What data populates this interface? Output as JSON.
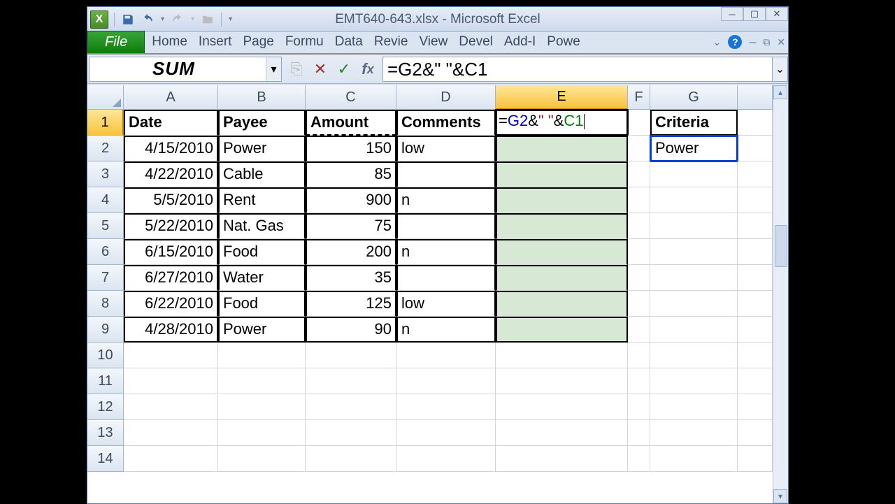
{
  "title": "EMT640-643.xlsx - Microsoft Excel",
  "tabs": {
    "file": "File",
    "home": "Home",
    "insert": "Insert",
    "page": "Page",
    "formulas": "Formu",
    "data": "Data",
    "review": "Revie",
    "view": "View",
    "devel": "Devel",
    "addins": "Add-I",
    "power": "Powe"
  },
  "namebox": "SUM",
  "formula": "=G2&\" \"&C1",
  "columns": [
    "A",
    "B",
    "C",
    "D",
    "E",
    "F",
    "G"
  ],
  "rows": [
    "1",
    "2",
    "3",
    "4",
    "5",
    "6",
    "7",
    "8",
    "9",
    "10",
    "11",
    "12",
    "13",
    "14"
  ],
  "headers": {
    "A": "Date",
    "B": "Payee",
    "C": "Amount",
    "D": "Comments",
    "G": "Criteria"
  },
  "editing_formula_parts": {
    "eq": "=",
    "g2": "G2",
    "amp1": "&",
    "str": "\" \"",
    "amp2": "&",
    "c1": "C1"
  },
  "data": [
    {
      "date": "4/15/2010",
      "payee": "Power",
      "amount": "150",
      "comments": "low"
    },
    {
      "date": "4/22/2010",
      "payee": "Cable",
      "amount": "85",
      "comments": ""
    },
    {
      "date": "5/5/2010",
      "payee": "Rent",
      "amount": "900",
      "comments": "n"
    },
    {
      "date": "5/22/2010",
      "payee": "Nat. Gas",
      "amount": "75",
      "comments": ""
    },
    {
      "date": "6/15/2010",
      "payee": "Food",
      "amount": "200",
      "comments": "n"
    },
    {
      "date": "6/27/2010",
      "payee": "Water",
      "amount": "35",
      "comments": ""
    },
    {
      "date": "6/22/2010",
      "payee": "Food",
      "amount": "125",
      "comments": "low"
    },
    {
      "date": "4/28/2010",
      "payee": "Power",
      "amount": "90",
      "comments": "n"
    }
  ],
  "criteria_value": "Power"
}
